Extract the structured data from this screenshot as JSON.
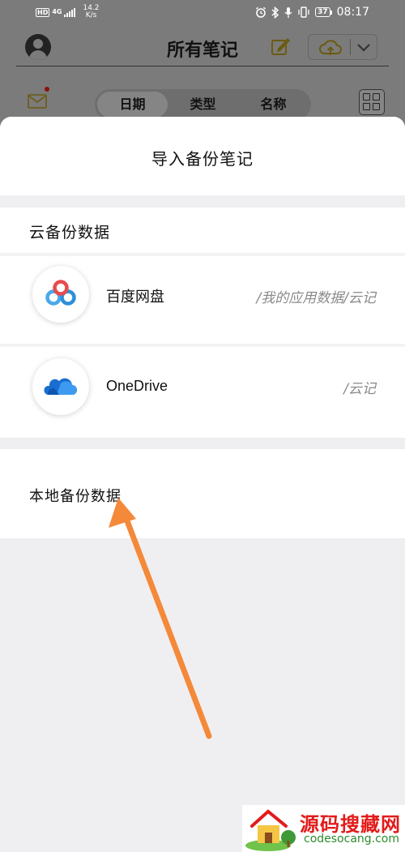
{
  "status_bar": {
    "hd": "HD",
    "network": "4G",
    "speed_value": "14.2",
    "speed_unit": "K/s",
    "battery": "37",
    "time": "08:17"
  },
  "header": {
    "title": "所有笔记"
  },
  "segments": [
    "日期",
    "类型",
    "名称"
  ],
  "sheet": {
    "title": "导入备份笔记",
    "cloud_section_label": "云备份数据",
    "rows": [
      {
        "name": "百度网盘",
        "path": "/我的应用数据/云记",
        "icon": "baidu-netdisk-icon"
      },
      {
        "name": "OneDrive",
        "path": "/云记",
        "icon": "onedrive-icon"
      }
    ],
    "local_section_label": "本地备份数据"
  },
  "watermark": {
    "title": "源码搜藏网",
    "url": "codesocang.com"
  },
  "colors": {
    "dim_background": "#7b7b7b",
    "sheet_background": "#efeff1",
    "arrow": "#f4893a",
    "watermark_red": "#e21b1b"
  }
}
